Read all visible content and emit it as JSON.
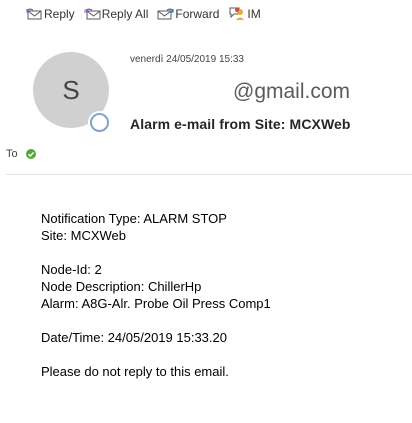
{
  "toolbar": {
    "reply_label": "Reply",
    "reply_all_label": "Reply All",
    "forward_label": "Forward",
    "im_label": "IM"
  },
  "message": {
    "avatar_initial": "S",
    "date": "venerdì 24/05/2019 15:33",
    "sender": "@gmail.com",
    "subject": "Alarm e-mail from Site: MCXWeb",
    "to_label": "To"
  },
  "body": {
    "notification_type": "Notification Type: ALARM STOP",
    "site": "Site: MCXWeb",
    "node_id": "Node-Id: 2",
    "node_description": "Node Description: ChillerHp",
    "alarm": "Alarm: A8G-Alr. Probe Oil Press Comp1",
    "datetime": "Date/Time: 24/05/2019 15:33.20",
    "footer": "Please do not reply to this email."
  },
  "colors": {
    "accent_green": "#52a83b",
    "presence_ring": "#7fa4c6",
    "avatar_bg": "#d0d0d0"
  }
}
